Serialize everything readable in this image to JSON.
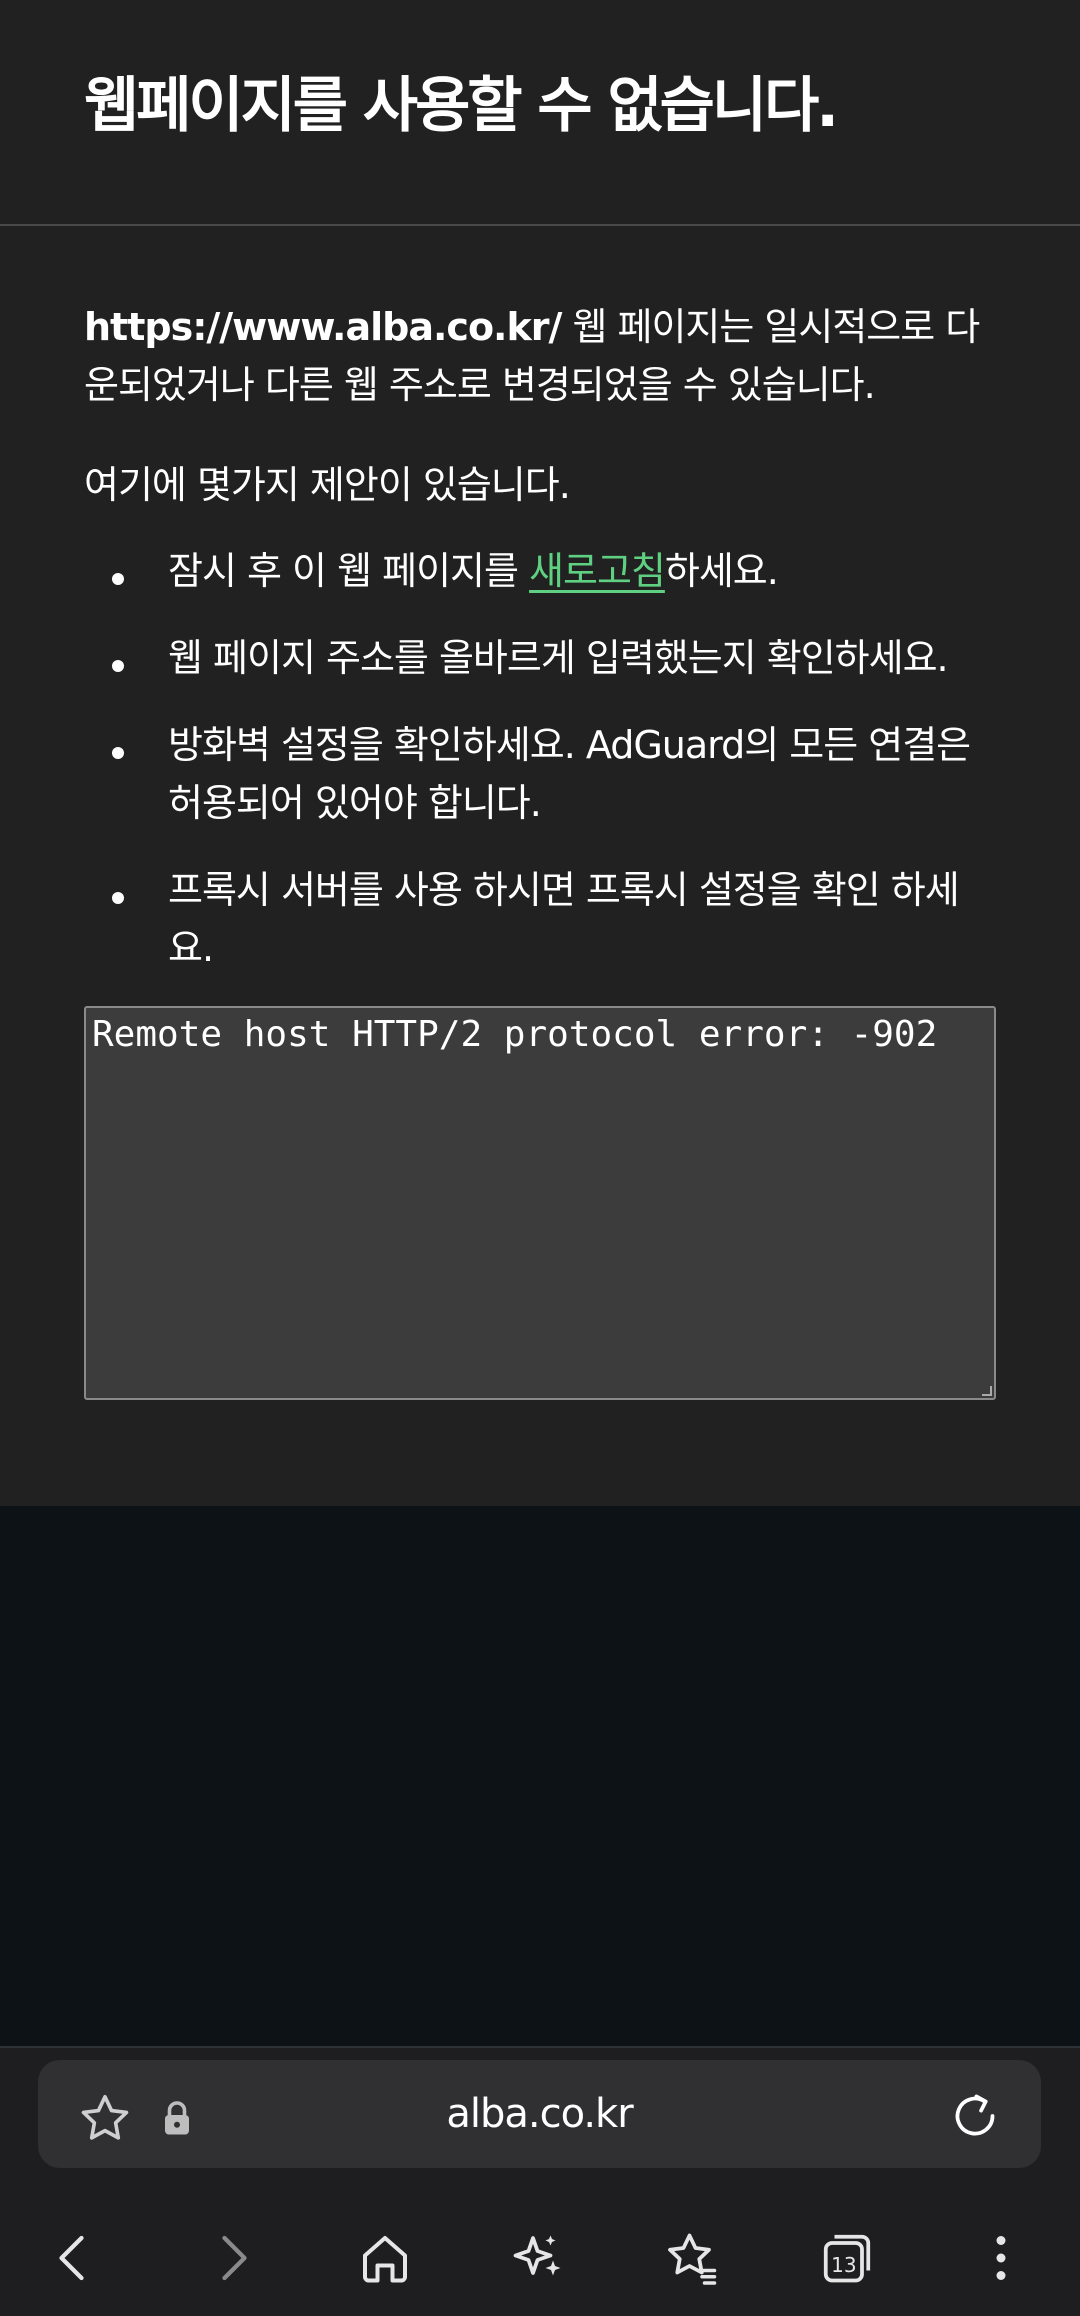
{
  "error_page": {
    "title": "웹페이지를 사용할 수 없습니다.",
    "description_url": "https://www.alba.co.kr/",
    "description_text": " 웹 페이지는 일시적으로 다운되었거나 다른 웹 주소로 변경되었을 수 있습니다.",
    "suggestions_heading": "여기에 몇가지 제안이 있습니다.",
    "suggestions": [
      {
        "before": "잠시 후 이 웹 페이지를 ",
        "link": "새로고침",
        "after": "하세요."
      },
      {
        "text": "웹 페이지 주소를 올바르게 입력했는지 확인하세요."
      },
      {
        "text": "방화벽 설정을 확인하세요. AdGuard의 모든 연결은 허용되어 있어야 합니다."
      },
      {
        "text": "프록시 서버를 사용 하시면 프록시 설정을 확인 하세요."
      }
    ],
    "error_detail": "Remote host HTTP/2 protocol error: -902",
    "link_color": "#5fd081"
  },
  "address_bar": {
    "domain": "alba.co.kr",
    "left_icons": [
      "star-outline-icon",
      "lock-icon"
    ],
    "right_icon": "reload-icon"
  },
  "nav_bar": {
    "tab_count": "13",
    "icons": [
      "back-icon",
      "forward-icon",
      "home-icon",
      "sparkle-icon",
      "bookmarks-icon",
      "tabs-icon",
      "more-icon"
    ]
  }
}
